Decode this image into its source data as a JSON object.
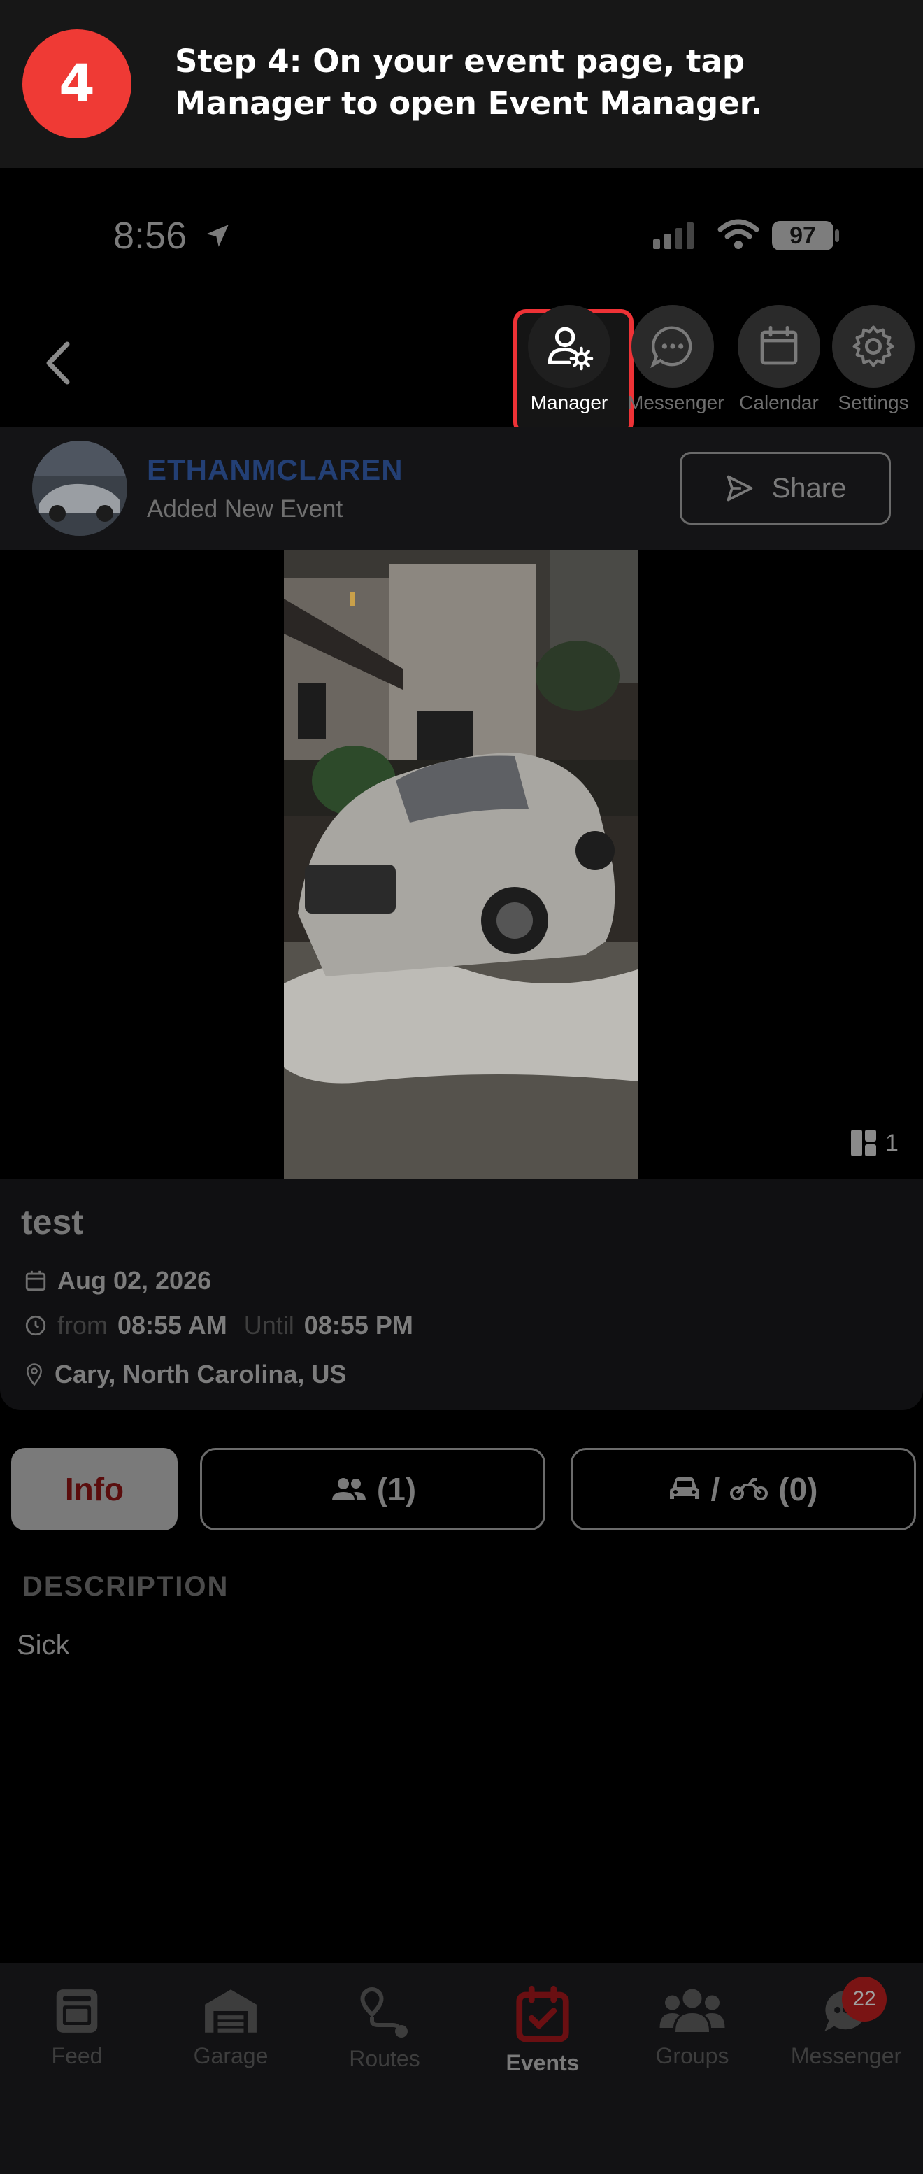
{
  "instruction": {
    "step_number": "4",
    "text": "Step 4: On your event page, tap Manager to open Event Manager."
  },
  "status_bar": {
    "time": "8:56",
    "battery": "97"
  },
  "toolbar": {
    "items": [
      {
        "label": "Manager",
        "icon": "manager-icon",
        "highlighted": true
      },
      {
        "label": "Messenger",
        "icon": "chat-icon"
      },
      {
        "label": "Calendar",
        "icon": "calendar-icon"
      },
      {
        "label": "Settings",
        "icon": "gear-icon"
      }
    ]
  },
  "author": {
    "name": "ETHANMCLAREN",
    "subtitle": "Added New Event",
    "share_label": "Share"
  },
  "media": {
    "count": "1"
  },
  "event": {
    "title": "test",
    "date": "Aug 02, 2026",
    "from_label": "from",
    "from_time": "08:55 AM",
    "until_label": "Until",
    "until_time": "08:55 PM",
    "location": "Cary, North Carolina, US"
  },
  "tabs": {
    "info_label": "Info",
    "attendees_label": "(1)",
    "vehicles_sep": "/",
    "vehicles_label": "(0)"
  },
  "description": {
    "heading": "DESCRIPTION",
    "body": "Sick"
  },
  "bottom_nav": {
    "items": [
      {
        "label": "Feed",
        "icon": "feed-icon"
      },
      {
        "label": "Garage",
        "icon": "garage-icon"
      },
      {
        "label": "Routes",
        "icon": "routes-icon"
      },
      {
        "label": "Events",
        "icon": "events-icon",
        "active": true
      },
      {
        "label": "Groups",
        "icon": "groups-icon"
      },
      {
        "label": "Messenger",
        "icon": "messenger-icon"
      }
    ],
    "messenger_badge": "22"
  },
  "colors": {
    "accent_red": "#ef3a35",
    "highlight_border": "#ee3236",
    "author_blue": "#233f74"
  }
}
